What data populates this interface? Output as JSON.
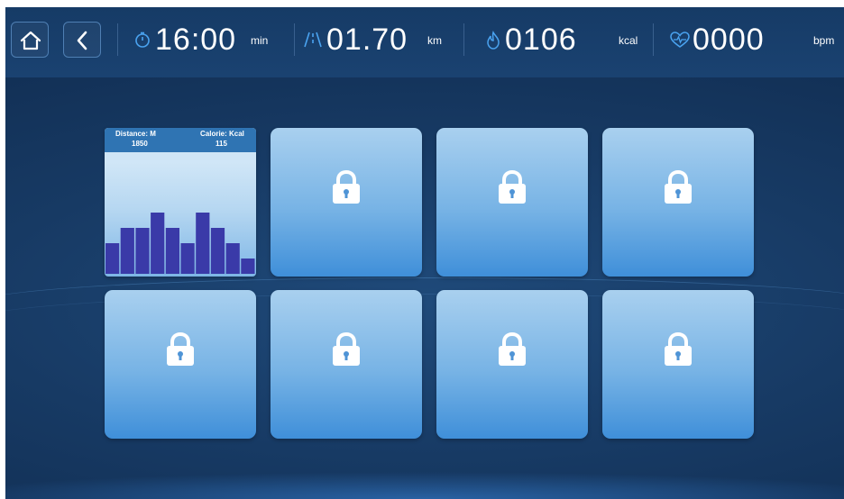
{
  "status_bar": {
    "time": {
      "value": "16:00",
      "unit": "min",
      "icon": "stopwatch-icon"
    },
    "distance": {
      "value": "01.70",
      "unit": "km",
      "icon": "road-icon"
    },
    "calories": {
      "value": "0106",
      "unit": "kcal",
      "icon": "flame-icon"
    },
    "heart_rate": {
      "value": "0000",
      "unit": "bpm",
      "icon": "heart-pulse-icon"
    }
  },
  "nav": {
    "home_icon": "home-icon",
    "back_icon": "back-chevron-icon"
  },
  "program_grid": {
    "preview_tile": {
      "distance_label": "Distance: M",
      "distance_value": "1850",
      "calorie_label": "Calorie: Kcal",
      "calorie_value": "115",
      "profile_levels": [
        4,
        6,
        6,
        8,
        6,
        4,
        8,
        6,
        4,
        2
      ],
      "max_level": 10,
      "bar_color": "#3a3aa8"
    },
    "locked_tiles": [
      {
        "icon": "lock-icon"
      },
      {
        "icon": "lock-icon"
      },
      {
        "icon": "lock-icon"
      },
      {
        "icon": "lock-icon"
      },
      {
        "icon": "lock-icon"
      },
      {
        "icon": "lock-icon"
      },
      {
        "icon": "lock-icon"
      }
    ]
  },
  "colors": {
    "background": "#173a64",
    "tile_gradient_top": "#a9d0ef",
    "tile_gradient_bottom": "#3f8fd9",
    "accent": "#4aa3f0"
  }
}
